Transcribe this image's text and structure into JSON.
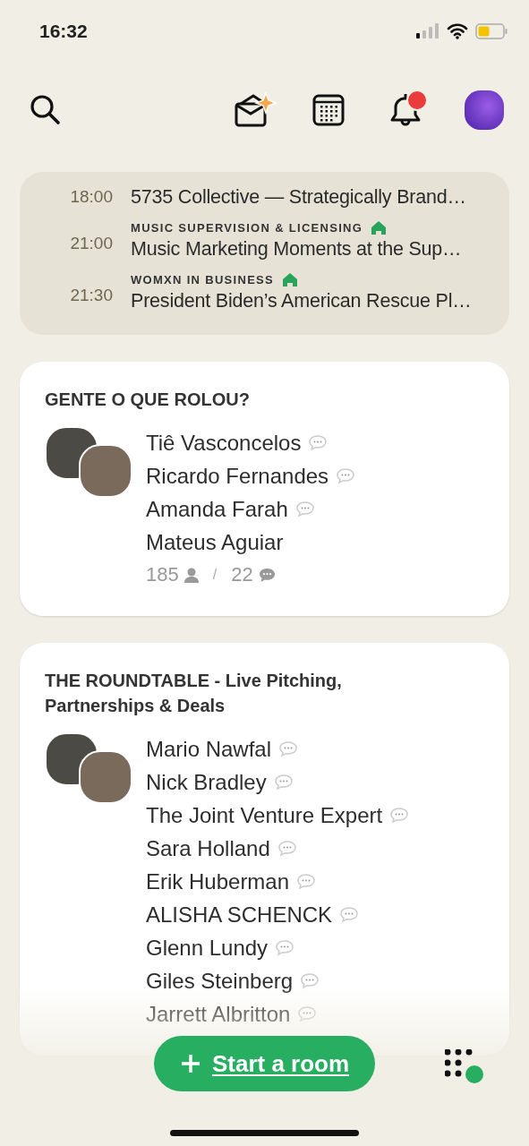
{
  "status_bar": {
    "time": "16:32"
  },
  "notifications": {
    "unread": true
  },
  "schedule": [
    {
      "time": "18:00",
      "title": "5735 Collective — Strategically Brand…"
    },
    {
      "time": "21:00",
      "club": "MUSIC SUPERVISION & LICENSING",
      "title": "Music Marketing Moments at the Sup…"
    },
    {
      "time": "21:30",
      "club": "WOMXN IN BUSINESS",
      "title": "President Biden’s American Rescue Pl…"
    }
  ],
  "rooms": [
    {
      "title": "GENTE O QUE ROLOU?",
      "speakers": [
        {
          "name": "Tiê Vasconcelos",
          "bubble": true
        },
        {
          "name": "Ricardo Fernandes",
          "bubble": true
        },
        {
          "name": "Amanda Farah",
          "bubble": true
        },
        {
          "name": "Mateus Aguiar",
          "bubble": false
        }
      ],
      "listeners": "185",
      "separator": "/",
      "speaker_count": "22"
    },
    {
      "title": "THE ROUNDTABLE - Live Pitching, Partnerships & Deals",
      "speakers": [
        {
          "name": "Mario Nawfal",
          "bubble": true
        },
        {
          "name": "Nick Bradley",
          "bubble": true
        },
        {
          "name": "The Joint Venture Expert",
          "bubble": true
        },
        {
          "name": "Sara Holland",
          "bubble": true
        },
        {
          "name": "Erik Huberman",
          "bubble": true
        },
        {
          "name": "ALISHA SCHENCK",
          "bubble": true
        },
        {
          "name": "Glenn Lundy",
          "bubble": true
        },
        {
          "name": "Giles Steinberg",
          "bubble": true
        },
        {
          "name": "Jarrett Albritton",
          "bubble": true
        }
      ]
    }
  ],
  "start_button": {
    "label": "Start a room"
  },
  "online_indicator": {
    "online": true
  }
}
